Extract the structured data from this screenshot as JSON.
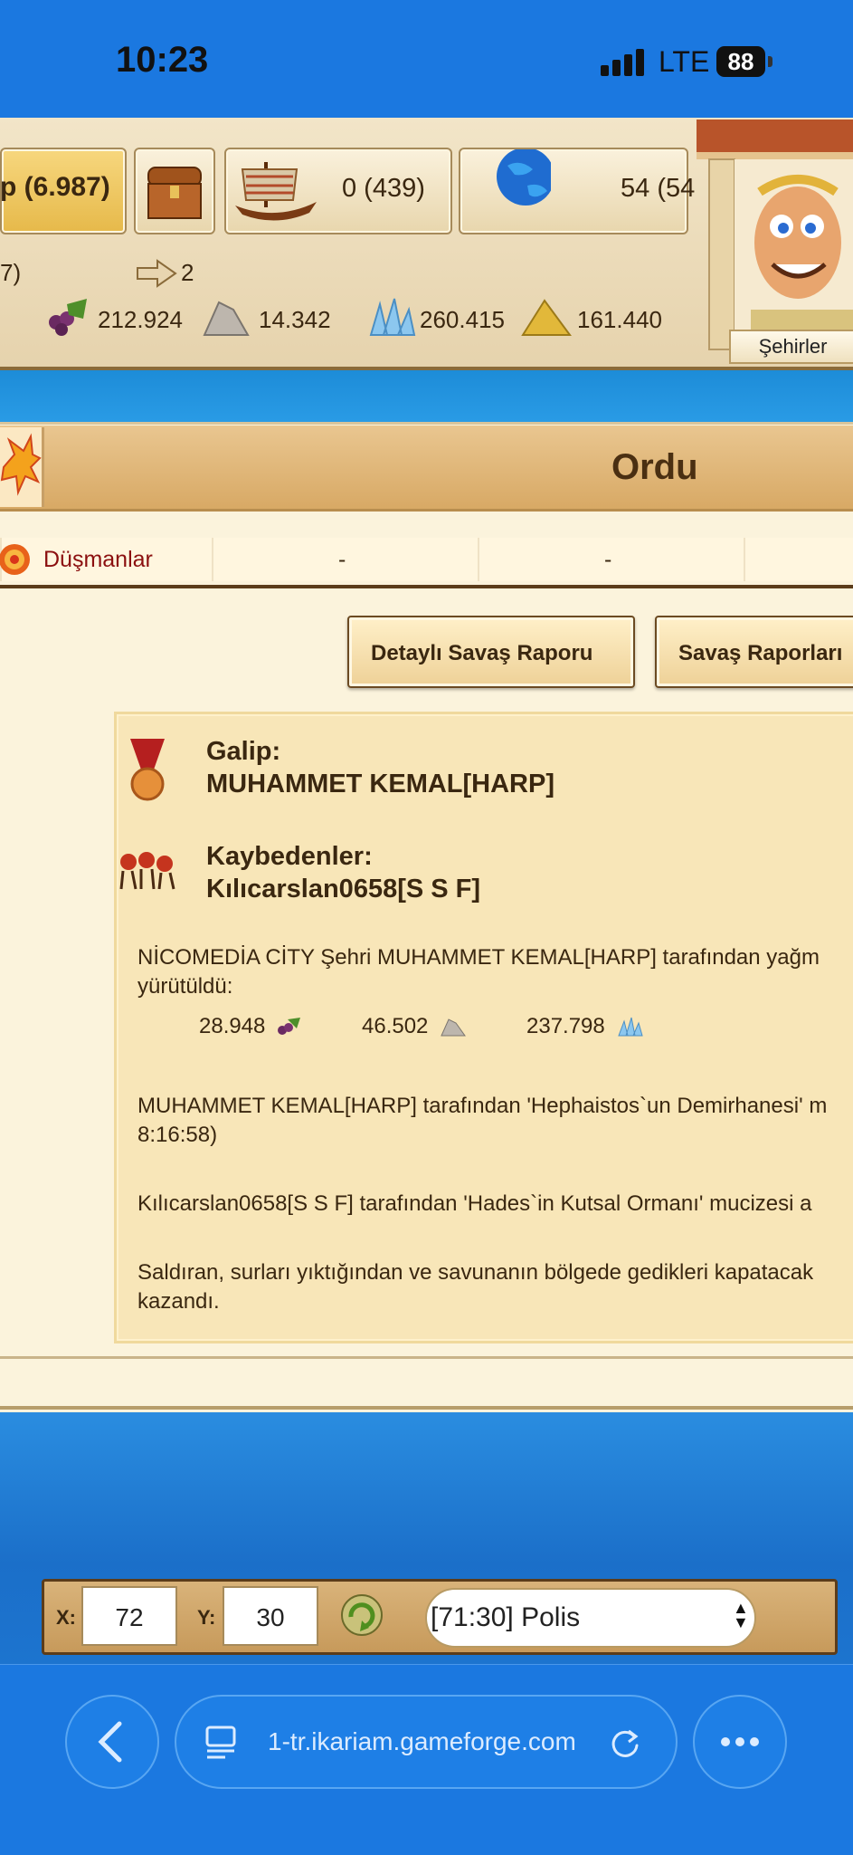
{
  "status_bar": {
    "time": "10:23",
    "network": "LTE",
    "battery": "88"
  },
  "resources": {
    "gold": "p (6.987)",
    "ships": "0 (439)",
    "points": "54 (54",
    "row2_left": "7)",
    "transports": "2",
    "wine": "212.924",
    "marble": "14.342",
    "crystal": "260.415",
    "sulfur": "161.440",
    "advisor_label": "Şehirler"
  },
  "panel": {
    "title": "Ordu",
    "enemies_label": "Düşmanlar",
    "enemies_values": [
      "-",
      "-"
    ],
    "buttons": {
      "detail": "Detaylı Savaş Raporu",
      "reports": "Savaş Raporları"
    }
  },
  "report": {
    "winner_label": "Galip:",
    "winner_name": "MUHAMMET KEMAL[HARP]",
    "losers_label": "Kaybedenler:",
    "loser_name": "Kılıcarslan0658[S S F]",
    "pillage_line1": "NİCOMEDİA CİTY Şehri MUHAMMET KEMAL[HARP] tarafından yağm",
    "pillage_line2": "yürütüldü:",
    "loot_wine": "28.948",
    "loot_marble": "46.502",
    "loot_crystal": "237.798",
    "miracle1_line1": "MUHAMMET KEMAL[HARP] tarafından 'Hephaistos`un Demirhanesi' m",
    "miracle1_line2": "8:16:58)",
    "miracle2_line1": "Kılıcarslan0658[S S F] tarafından 'Hades`in Kutsal Ormanı' mucizesi a",
    "walls_line1": "Saldıran, surları yıktığından ve savunanın bölgede gedikleri kapatacak",
    "walls_line2": "kazandı."
  },
  "coords": {
    "x_label": "X:",
    "x_value": "72",
    "y_label": "Y:",
    "y_value": "30",
    "city_select": "[71:30] Polis"
  },
  "browser": {
    "url": "1-tr.ikariam.gameforge.com"
  }
}
